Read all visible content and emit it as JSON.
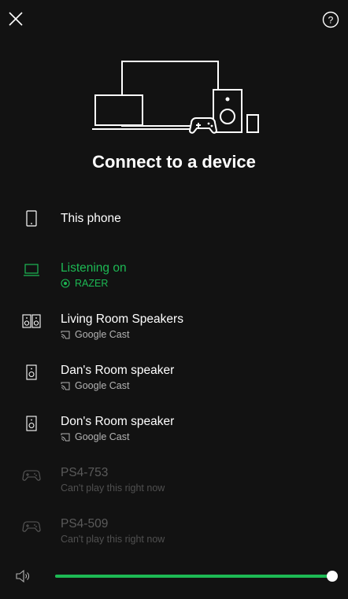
{
  "header": {
    "close_icon": "close-icon",
    "help_icon": "help-icon",
    "title": "Connect to a device"
  },
  "devices": [
    {
      "name": "This phone",
      "sub": "",
      "icon": "phone-icon",
      "state": "normal"
    },
    {
      "name": "Listening on",
      "sub": "RAZER",
      "icon": "laptop-icon",
      "sub_icon": "speaker-active-icon",
      "state": "active"
    },
    {
      "name": "Living Room Speakers",
      "sub": "Google Cast",
      "icon": "speakers-icon",
      "sub_icon": "cast-icon",
      "state": "normal"
    },
    {
      "name": "Dan's Room speaker",
      "sub": "Google Cast",
      "icon": "speaker-icon",
      "sub_icon": "cast-icon",
      "state": "normal"
    },
    {
      "name": "Don's Room speaker",
      "sub": "Google Cast",
      "icon": "speaker-icon",
      "sub_icon": "cast-icon",
      "state": "normal"
    },
    {
      "name": "PS4-753",
      "sub": "Can't play this right now",
      "icon": "gamepad-icon",
      "state": "disabled"
    },
    {
      "name": "PS4-509",
      "sub": "Can't play this right now",
      "icon": "gamepad-icon",
      "state": "disabled"
    }
  ],
  "volume": {
    "icon": "volume-icon",
    "level_percent": 100
  },
  "colors": {
    "accent": "#1db954",
    "background": "#121212",
    "text": "#ffffff",
    "muted": "#b3b3b3",
    "disabled": "#5a5a5a"
  }
}
